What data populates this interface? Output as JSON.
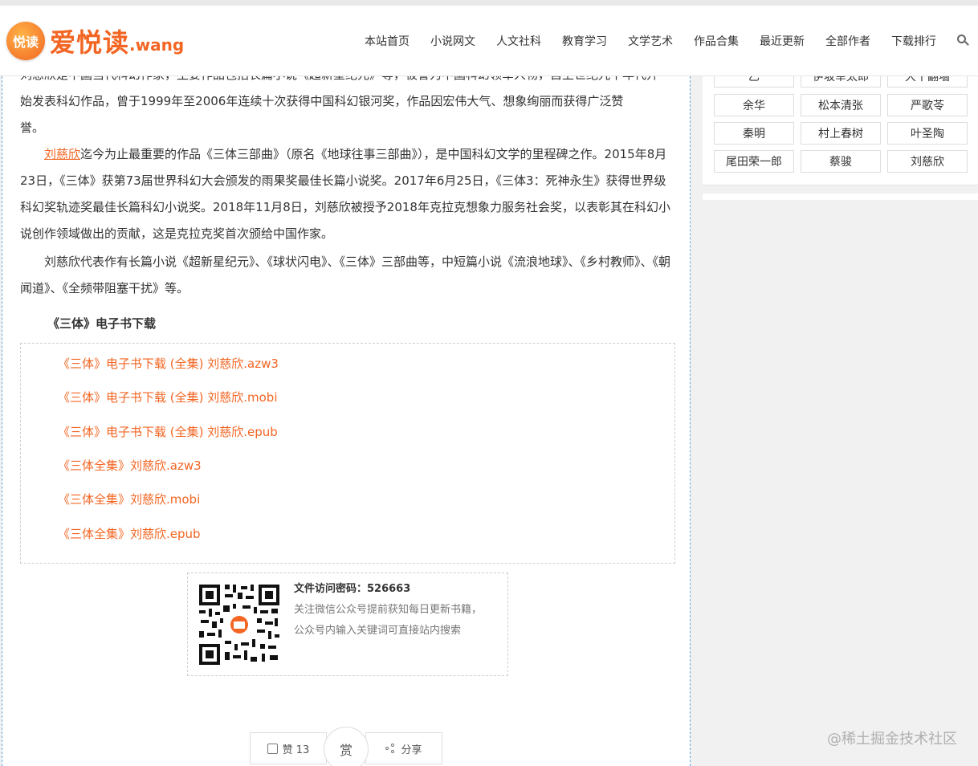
{
  "site": {
    "logo_badge": "悦读",
    "logo_text": "爱悦读",
    "logo_suffix": ".wang"
  },
  "nav": {
    "items": [
      "本站首页",
      "小说网文",
      "人文社科",
      "教育学习",
      "文学艺术",
      "作品合集",
      "最近更新",
      "全部作者",
      "下载排行"
    ],
    "search_icon": "search-icon"
  },
  "article": {
    "para0_line1": "刘慈欣是中国当代科幻作家，主要作品包括长篇小说《超新星纪元》等，被誉为中国科幻领军人物，自上世纪九十年代开",
    "para0_line2": "始发表科幻作品，曾于1999年至2006年连续十次获得中国科幻银河奖，作品因宏伟大气、想象绚丽而获得广泛赞",
    "para0_line3": "誉。",
    "para1_name": "刘慈欣",
    "para1_rest": "迄今为止最重要的作品《三体三部曲》（原名《地球往事三部曲》），是中国科幻文学的里程碑之作。2015年8月23日，《三体》获第73届世界科幻大会颁发的雨果奖最佳长篇小说奖。2017年6月25日，《三体3：死神永生》获得世界级科幻奖轨迹奖最佳长篇科幻小说奖。2018年11月8日，刘慈欣被授予2018年克拉克想象力服务社会奖，以表彰其在科幻小说创作领域做出的贡献，这是克拉克奖首次颁给中国作家。",
    "para2": "刘慈欣代表作有长篇小说《超新星纪元》、《球状闪电》、《三体》三部曲等，中短篇小说《流浪地球》、《乡村教师》、《朝闻道》、《全频带阻塞干扰》等。",
    "download_title": "《三体》电子书下载",
    "download_links": [
      "《三体》电子书下载 (全集) 刘慈欣.azw3",
      "《三体》电子书下载 (全集) 刘慈欣.mobi",
      "《三体》电子书下载 (全集) 刘慈欣.epub",
      "《三体全集》刘慈欣.azw3",
      "《三体全集》刘慈欣.mobi",
      "《三体全集》刘慈欣.epub"
    ],
    "qr_title": "文件访问密码：526663",
    "qr_line1": "关注微信公众号提前获知每日更新书籍，",
    "qr_line2": "公众号内输入关键词可直接站内搜索",
    "like_label": "赞 13",
    "reward_label": "赏",
    "share_label": "分享"
  },
  "sidebar": {
    "tags": [
      "乙",
      "伊坂幸太郎",
      "大干翻墙",
      "余华",
      "松本清张",
      "严歌苓",
      "秦明",
      "村上春树",
      "叶圣陶",
      "尾田荣一郎",
      "蔡骏",
      "刘慈欣"
    ]
  },
  "watermark": "@稀土掘金技术社区",
  "colors": {
    "accent": "#f26522",
    "border_dashed": "#6aa4d9"
  }
}
